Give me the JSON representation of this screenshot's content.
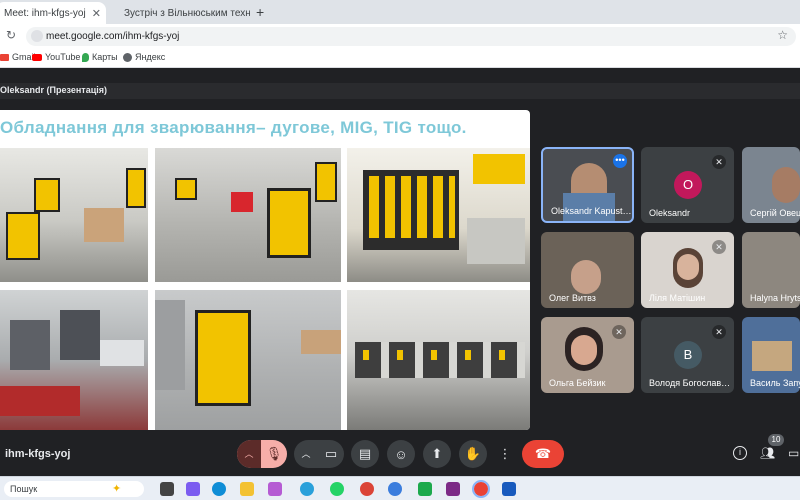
{
  "browser": {
    "tabs": [
      {
        "label": "Meet: ihm-kfgs-yoj"
      },
      {
        "label": "Зустріч з Вільнюським технічн"
      }
    ],
    "url": "meet.google.com/ihm-kfgs-yoj",
    "bookmarks": [
      "Gmail",
      "YouTube",
      "Карты",
      "Яндекс"
    ]
  },
  "meet": {
    "presenter_label": "Oleksandr (Презентація)",
    "slide_title": "Обладнання для зварювання– дугове, MIG, TIG тощо.",
    "meeting_code": "ihm-kfgs-yoj",
    "participants_count": "10",
    "participants": [
      {
        "name": "Oleksandr Kapust…"
      },
      {
        "name": "Oleksandr",
        "initial": "O"
      },
      {
        "name": "Сергій Овец"
      },
      {
        "name": "Олег Витвз"
      },
      {
        "name": "Ліля Матішин"
      },
      {
        "name": "Halyna Hryts"
      },
      {
        "name": "Ольга Бейзик"
      },
      {
        "name": "Володя Богослав…",
        "initial": "B"
      },
      {
        "name": "Василь Запу"
      }
    ]
  },
  "taskbar": {
    "search_placeholder": "Пошук"
  },
  "colors": {
    "accent_blue": "#8ab4f8",
    "end_call_red": "#ea4335",
    "mic_off_bg": "#f6aea9"
  }
}
